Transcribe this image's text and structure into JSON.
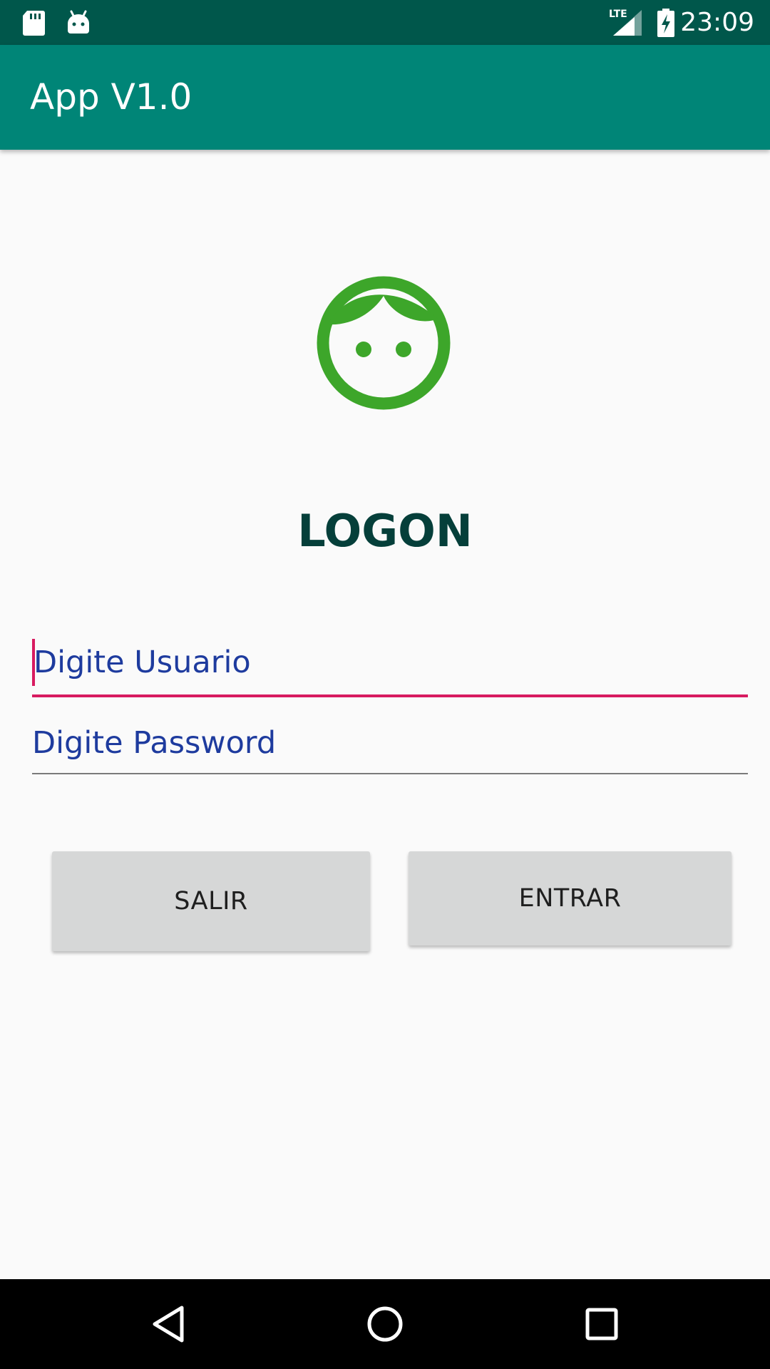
{
  "status_bar": {
    "time": "23:09",
    "network": "LTE",
    "icons": [
      "sd-card-icon",
      "android-icon",
      "signal-icon",
      "battery-charging-icon"
    ]
  },
  "app_bar": {
    "title": "App V1.0"
  },
  "logon": {
    "avatar_icon": "face-icon",
    "title": "LOGON",
    "username_placeholder": "Digite Usuario",
    "password_placeholder": "Digite Password",
    "exit_label": "SALIR",
    "enter_label": "ENTRAR"
  },
  "nav_bar": {
    "buttons": [
      "back-icon",
      "home-icon",
      "recents-icon"
    ]
  },
  "colors": {
    "status_bar": "#00574b",
    "app_bar": "#008577",
    "accent": "#d81b60",
    "avatar": "#3da62a",
    "title": "#053f3a",
    "hint_text": "#1e3b9e",
    "button_bg": "#d6d7d7"
  }
}
